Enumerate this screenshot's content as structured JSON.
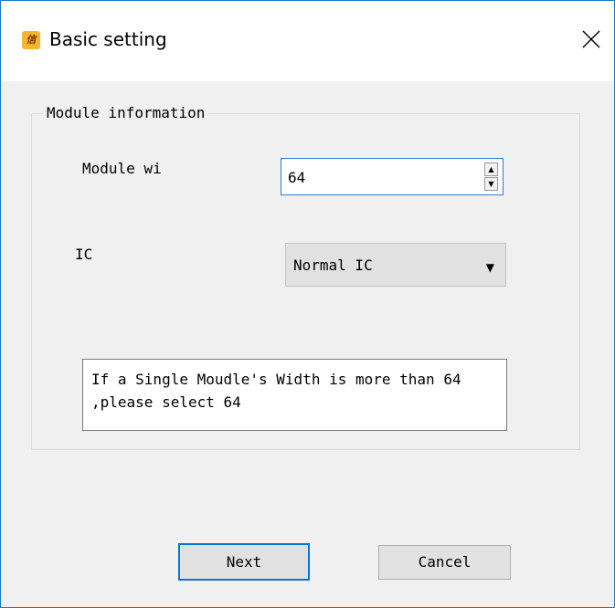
{
  "window": {
    "title": "Basic setting",
    "icon": "app-logo-icon",
    "icon_text": "信",
    "close_icon": "close-icon"
  },
  "group": {
    "label": "Module information"
  },
  "fields": {
    "module_width": {
      "label": "Module wi",
      "value": "64",
      "up_icon": "▲",
      "down_icon": "▼"
    },
    "ic": {
      "label": "IC",
      "value": "Normal IC",
      "arrow_icon": "▼"
    }
  },
  "info": {
    "text": "If a Single Moudle's Width is more than 64 ,please select 64"
  },
  "buttons": {
    "next_label": "Next",
    "cancel_label": "Cancel"
  },
  "colors": {
    "accent": "#0078d7",
    "window_border": "#1979ca",
    "icon_bg": "#f5b52e"
  }
}
